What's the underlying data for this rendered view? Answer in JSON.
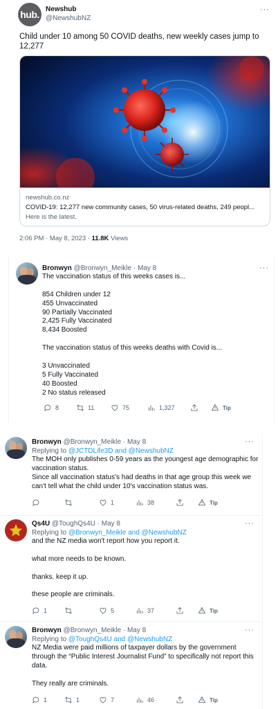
{
  "main": {
    "author": "Newshub",
    "handle": "@NewshubNZ",
    "logo_text": "hub.",
    "text_lines": [
      "Child under 10 among 50 COVID deaths, new weekly cases jump to",
      "12,277"
    ],
    "card": {
      "domain": "newshub.co.nz",
      "title": "COVID-19: 12,277 new community cases, 50 virus-related deaths, 249 peopl...",
      "desc": "Here is the latest."
    },
    "time": "2:06 PM · May 8, 2023 · ",
    "views_count": "11.8K",
    "views_label": " Views"
  },
  "replies": [
    {
      "name": "Bronwyn",
      "handle": "@Bronwyn_Meikle · May 8",
      "lines": [
        "The vaccination status of this weeks cases is...",
        "",
        "854 Children under 12",
        "455 Unvaccinated",
        "90 Partially Vaccinated",
        "2,425 Fully Vaccinated",
        "8,434 Boosted",
        "",
        "The vaccination status of this weeks deaths with Covid is...",
        "",
        "3 Unvaccinated",
        "5 Fully Vaccinated",
        "40 Boosted",
        "2 No status released"
      ],
      "stats": {
        "reply": "8",
        "retweet": "11",
        "like": "75",
        "views": "1,327",
        "tip": "Tip"
      }
    },
    {
      "name": "Bronwyn",
      "handle": "@Bronwyn_Meikle · May 8",
      "reply_prefix": "Replying to ",
      "reply_to": "@JCTDLife3D and @NewshubNZ",
      "lines": [
        "The MOH only publishes 0-59 years as the youngest age demographic for",
        "vaccination status.",
        "Since all vaccination status's had deaths in that age group this week we",
        "can't tell what the child under 10's vaccination status was."
      ],
      "stats": {
        "reply": "",
        "retweet": "",
        "like": "1",
        "views": "38",
        "tip": "Tip"
      }
    },
    {
      "name": "Qs4U",
      "handle": "@ToughQs4U · May 8",
      "reply_prefix": "Replying to ",
      "reply_to": "@Bronwyn_Meikle and @NewshubNZ",
      "lines": [
        "and the NZ media won't report how you report it.",
        "",
        "what more needs to be known.",
        "",
        "thanks. keep it up.",
        "",
        "these people  are criminals."
      ],
      "stats": {
        "reply": "1",
        "retweet": "",
        "like": "5",
        "views": "37",
        "tip": "Tip"
      }
    },
    {
      "name": "Bronwyn",
      "handle": "@Bronwyn_Meikle · May 8",
      "reply_prefix": "Replying to ",
      "reply_to": "@ToughQs4U and @NewshubNZ",
      "lines": [
        "NZ Media were paid millions of taxpayer dollars by the government",
        "through the “Public Interest Journalist Fund” to specifically not report this",
        "data.",
        "",
        "They really are criminals."
      ],
      "stats": {
        "reply": "1",
        "retweet": "1",
        "like": "7",
        "views": "46",
        "tip": "Tip"
      }
    }
  ],
  "colors": {
    "link": "#1d9bf0",
    "secondary": "#536471",
    "text": "#0f1419",
    "qs_avatar_bg": "#b3261e",
    "qs_star": "#e8c31b"
  },
  "icons": [
    "more-icon",
    "reply-icon",
    "retweet-icon",
    "like-icon",
    "views-icon",
    "share-icon",
    "tip-icon"
  ]
}
